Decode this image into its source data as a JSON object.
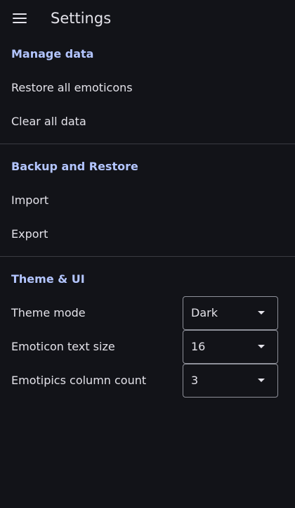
{
  "app_bar": {
    "title": "Settings",
    "menu_icon": "menu-icon"
  },
  "sections": {
    "manage_data": {
      "header": "Manage data",
      "items": [
        "Restore all emoticons",
        "Clear all data"
      ]
    },
    "backup": {
      "header": "Backup and Restore",
      "items": [
        "Import",
        "Export"
      ]
    },
    "theme": {
      "header": "Theme & UI",
      "settings": [
        {
          "label": "Theme mode",
          "value": "Dark"
        },
        {
          "label": "Emoticon text size",
          "value": "16"
        },
        {
          "label": "Emotipics column count",
          "value": "3"
        }
      ]
    }
  },
  "colors": {
    "background": "#121318",
    "accent": "#b3c5ff",
    "text": "#e3e2e9",
    "divider": "#3a3b42",
    "outline": "#8e9099"
  }
}
